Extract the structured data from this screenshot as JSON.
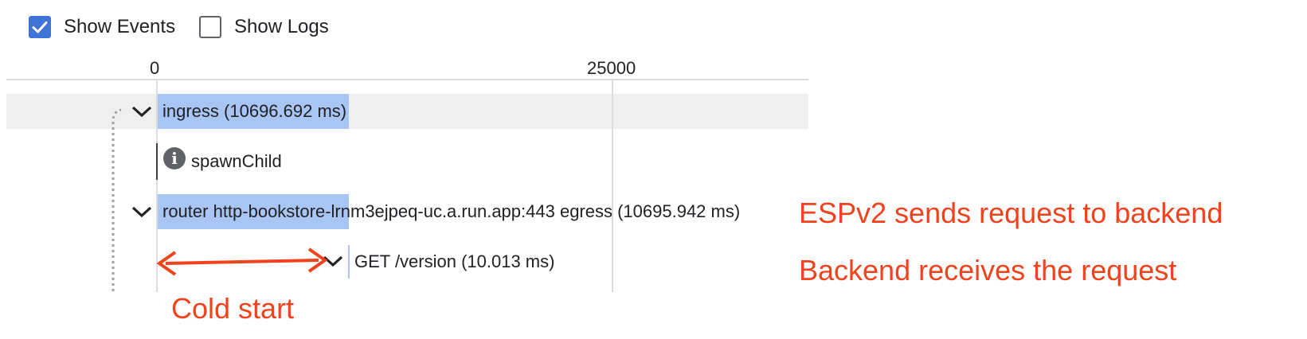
{
  "toolbar": {
    "show_events": {
      "label": "Show Events",
      "checked": true
    },
    "show_logs": {
      "label": "Show Logs",
      "checked": false
    }
  },
  "axis": {
    "ticks": [
      "0",
      "25000"
    ]
  },
  "spans": [
    {
      "label": "ingress (10696.692 ms)",
      "duration_ms": 10696.692,
      "expanded": true
    },
    {
      "label": "spawnChild",
      "type": "event"
    },
    {
      "label": "router http-bookstore-lrnm3ejpeq-uc.a.run.app:443 egress (10695.942 ms)",
      "duration_ms": 10695.942,
      "expanded": true
    },
    {
      "label": "GET /version (10.013 ms)",
      "duration_ms": 10.013,
      "expanded": true
    }
  ],
  "annotations": {
    "sends": "ESPv2 sends request to backend",
    "receives": "Backend receives the request",
    "cold_start": "Cold start"
  },
  "colors": {
    "accent": "#3f73d8",
    "bar": "#a9c5f3",
    "annotation": "#f0421c"
  }
}
